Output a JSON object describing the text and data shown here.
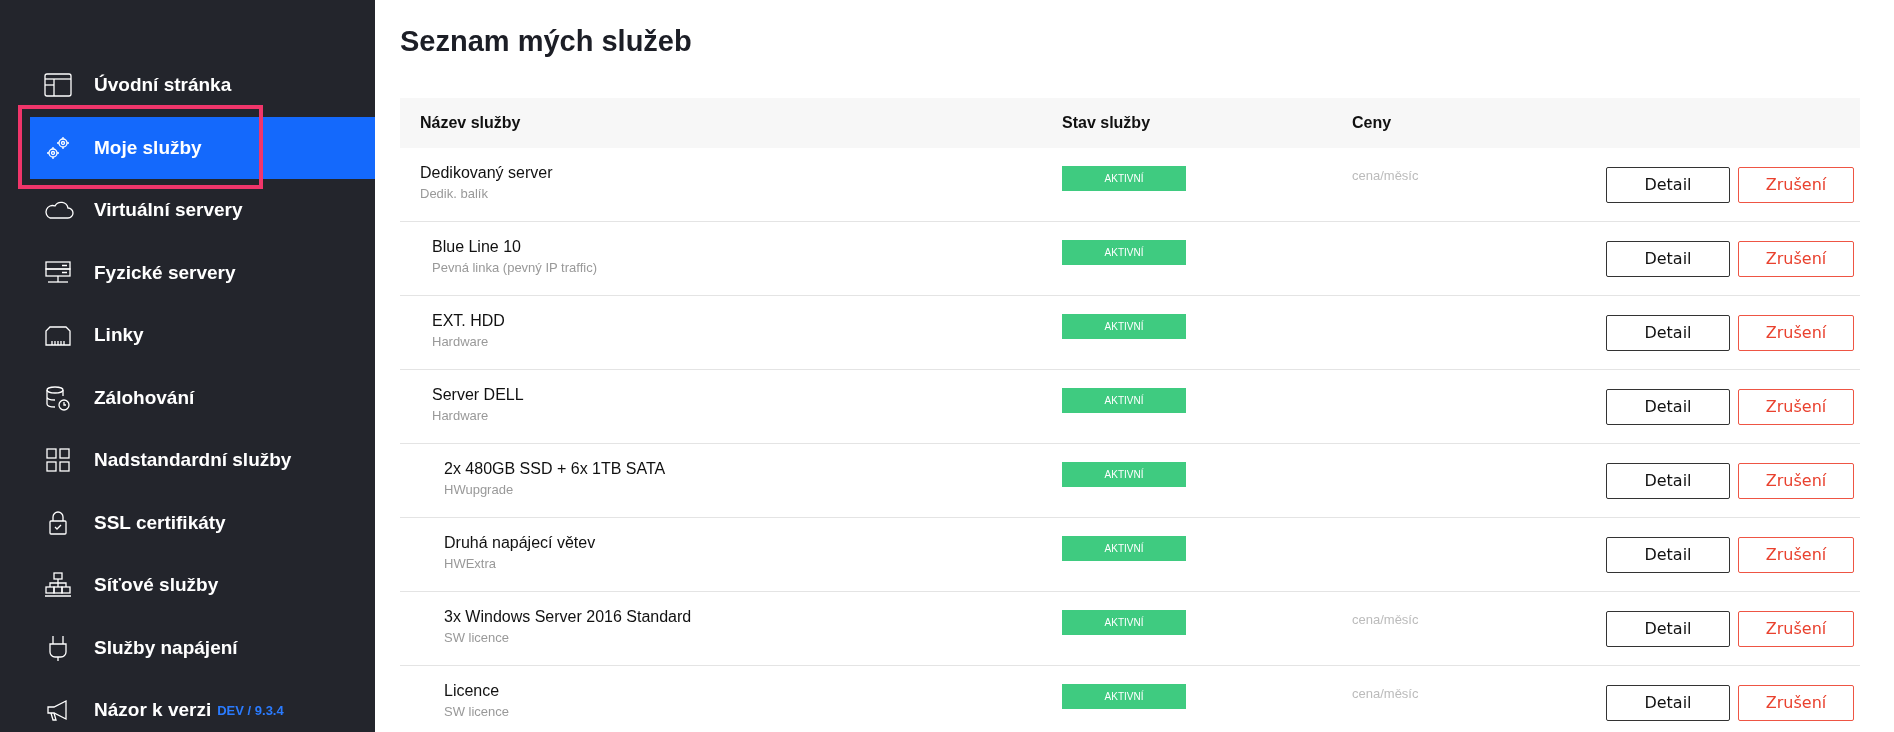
{
  "sidebar": {
    "items": [
      {
        "label": "Úvodní stránka",
        "selected": false,
        "highlighted": false
      },
      {
        "label": "Moje služby",
        "selected": true,
        "highlighted": true
      },
      {
        "label": "Virtuální servery",
        "selected": false,
        "highlighted": false
      },
      {
        "label": "Fyzické servery",
        "selected": false,
        "highlighted": false
      },
      {
        "label": "Linky",
        "selected": false,
        "highlighted": false
      },
      {
        "label": "Zálohování",
        "selected": false,
        "highlighted": false
      },
      {
        "label": "Nadstandardní služby",
        "selected": false,
        "highlighted": false
      },
      {
        "label": "SSL certifikáty",
        "selected": false,
        "highlighted": false
      },
      {
        "label": "Síťové služby",
        "selected": false,
        "highlighted": false
      },
      {
        "label": "Služby napájení",
        "selected": false,
        "highlighted": false
      },
      {
        "label": "Názor k verzi",
        "selected": false,
        "highlighted": false,
        "version": "DEV / 9.3.4"
      }
    ]
  },
  "page": {
    "title": "Seznam mých služeb"
  },
  "table": {
    "columns": [
      "Název služby",
      "Stav služby",
      "Ceny"
    ],
    "rows": [
      {
        "name": "Dedikovaný server",
        "type": "Dedik. balík",
        "status": "AKTIVNÍ",
        "price": "cena/měsíc",
        "detail": "Detail",
        "cancel": "Zrušení",
        "children": [
          {
            "name": "Blue Line 10",
            "type": "Pevná linka (pevný IP traffic)",
            "status": "AKTIVNÍ",
            "detail": "Detail",
            "cancel": "Zrušení"
          },
          {
            "name": "EXT. HDD",
            "type": "Hardware",
            "status": "AKTIVNÍ",
            "detail": "Detail",
            "cancel": "Zrušení"
          },
          {
            "name": "Server DELL",
            "type": "Hardware",
            "status": "AKTIVNÍ",
            "detail": "Detail",
            "cancel": "Zrušení",
            "children": [
              {
                "name": "2x 480GB SSD + 6x 1TB SATA",
                "type": "HWupgrade",
                "status": "AKTIVNÍ",
                "detail": "Detail",
                "cancel": "Zrušení"
              },
              {
                "name": "Druhá napájecí větev",
                "type": "HWExtra",
                "status": "AKTIVNÍ",
                "detail": "Detail",
                "cancel": "Zrušení"
              },
              {
                "name": "3x Windows Server 2016 Standard",
                "type": "SW licence",
                "status": "AKTIVNÍ",
                "price": "cena/měsíc",
                "detail": "Detail",
                "cancel": "Zrušení"
              },
              {
                "name": "Licence",
                "type": "SW licence",
                "status": "AKTIVNÍ",
                "price": "cena/měsíc",
                "detail": "Detail",
                "cancel": "Zrušení"
              }
            ]
          }
        ]
      }
    ]
  }
}
